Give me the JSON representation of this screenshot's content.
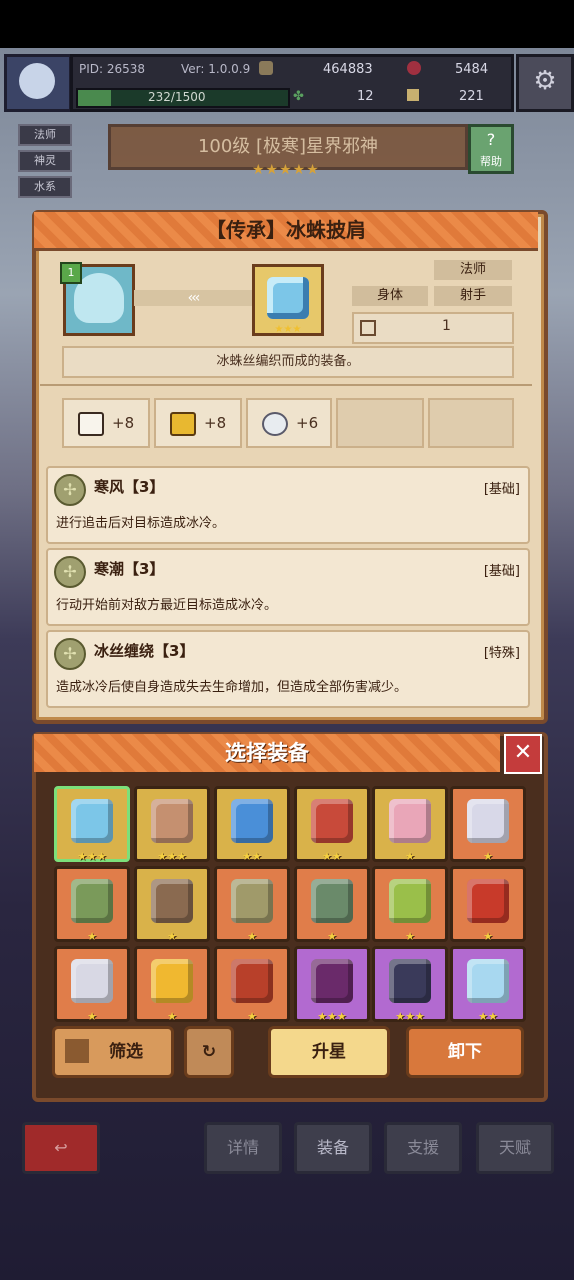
{
  "player": {
    "pid": "PID: 26538",
    "version": "Ver: 1.0.0.9",
    "gold": "464883",
    "gems": "5484",
    "hp": "232/1500",
    "clovers": "12",
    "boots": "221"
  },
  "chips": [
    "法师",
    "神灵",
    "水系"
  ],
  "boss": {
    "title": "100级 [极寒]星界邪神",
    "help_label": "帮助",
    "stars": "★★★★★"
  },
  "item": {
    "title": "【传承】冰蛛披肩",
    "portrait_level": "1",
    "arrows": "‹‹‹",
    "item_stars": "★★★",
    "tags": {
      "class": "法师",
      "slot": "身体",
      "type": "射手"
    },
    "count": "1",
    "description": "冰蛛丝编织而成的装备。",
    "attributes": [
      {
        "icon": "book-icon",
        "value": "+8"
      },
      {
        "icon": "gold-bar-icon",
        "value": "+8"
      },
      {
        "icon": "stone-icon",
        "value": "+6"
      }
    ],
    "skills": [
      {
        "name": "寒风【3】",
        "type": "[基础]",
        "desc": "进行追击后对目标造成冰冷。"
      },
      {
        "name": "寒潮【3】",
        "type": "[基础]",
        "desc": "行动开始前对敌方最近目标造成冰冷。"
      },
      {
        "name": "冰丝缠绕【3】",
        "type": "[特殊]",
        "desc": "造成冰冷后使自身造成失去生命增加，但造成全部伤害减少。"
      }
    ]
  },
  "selection": {
    "title": "选择装备",
    "close": "✕",
    "slots": [
      {
        "bg": "#d9b24a",
        "color": "#7cc6e8",
        "stars": "★★★",
        "selected": true
      },
      {
        "bg": "#d9b24a",
        "color": "#c59070",
        "stars": "★★★"
      },
      {
        "bg": "#d9b24a",
        "color": "#4a8fd8",
        "stars": "★★"
      },
      {
        "bg": "#d9b24a",
        "color": "#c84a3a",
        "stars": "★★"
      },
      {
        "bg": "#d9b24a",
        "color": "#e9a6b8",
        "stars": "★"
      },
      {
        "bg": "#e07d4a",
        "color": "#d8d8e8",
        "stars": "★"
      },
      {
        "bg": "#e07d4a",
        "color": "#7a9a5a",
        "stars": "★"
      },
      {
        "bg": "#d9b24a",
        "color": "#8a6a50",
        "stars": "★"
      },
      {
        "bg": "#e07d4a",
        "color": "#a09a6a",
        "stars": "★"
      },
      {
        "bg": "#e07d4a",
        "color": "#6a8a6a",
        "stars": "★"
      },
      {
        "bg": "#e07d4a",
        "color": "#9abf4a",
        "stars": "★"
      },
      {
        "bg": "#e07d4a",
        "color": "#c83a2a",
        "stars": "★"
      },
      {
        "bg": "#e07d4a",
        "color": "#d8d8e4",
        "stars": "★"
      },
      {
        "bg": "#e07d4a",
        "color": "#f0b830",
        "stars": "★"
      },
      {
        "bg": "#e07d4a",
        "color": "#b8402a",
        "stars": "★"
      },
      {
        "bg": "#b26ad0",
        "color": "#6a2a6a",
        "stars": "★★★"
      },
      {
        "bg": "#b26ad0",
        "color": "#3a3a5a",
        "stars": "★★★"
      },
      {
        "bg": "#b26ad0",
        "color": "#a8d8f0",
        "stars": "★★"
      }
    ],
    "buttons": {
      "filter": "筛选",
      "upgrade": "升星",
      "unequip": "卸下"
    }
  },
  "nav": {
    "details": "详情",
    "equipment": "装备",
    "support": "支援",
    "talent": "天赋"
  },
  "colors": {
    "accent_orange": "#e07a3a",
    "panel_brown": "#7a4a2c",
    "parchment": "#e8d5b5"
  }
}
